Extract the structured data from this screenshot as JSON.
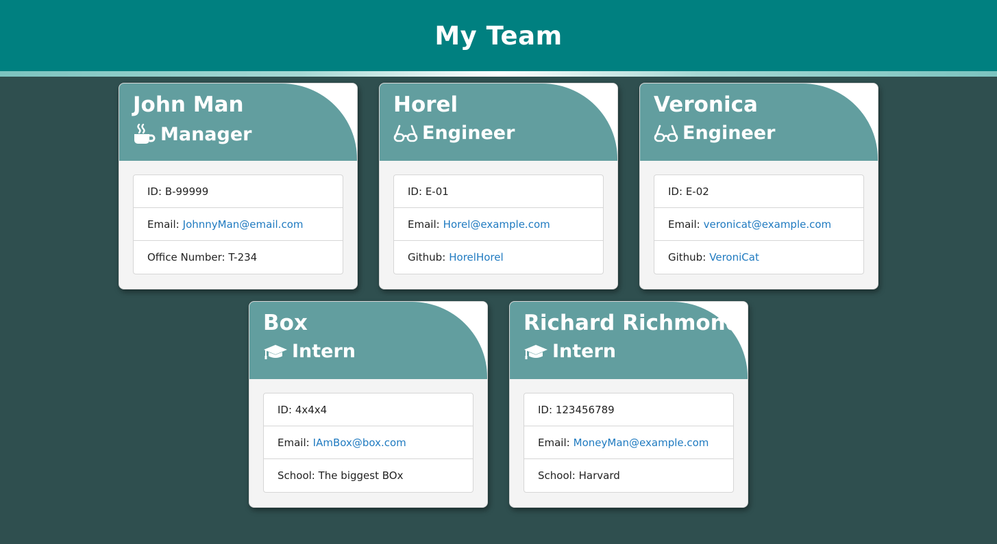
{
  "header": {
    "title": "My Team"
  },
  "employees": [
    {
      "name": "John Man",
      "role": "Manager",
      "role_icon": "coffee-icon",
      "id_label": "ID:",
      "id": "B-99999",
      "email_label": "Email:",
      "email": "JohnnyMan@email.com",
      "extra_label": "Office Number:",
      "extra": "T-234"
    },
    {
      "name": "Horel",
      "role": "Engineer",
      "role_icon": "glasses-icon",
      "id_label": "ID:",
      "id": "E-01",
      "email_label": "Email:",
      "email": "Horel@example.com",
      "extra_label": "Github:",
      "extra": "HorelHorel"
    },
    {
      "name": "Veronica",
      "role": "Engineer",
      "role_icon": "glasses-icon",
      "id_label": "ID:",
      "id": "E-02",
      "email_label": "Email:",
      "email": "veronicat@example.com",
      "extra_label": "Github:",
      "extra": "VeroniCat"
    },
    {
      "name": "Box",
      "role": "Intern",
      "role_icon": "graduation-cap-icon",
      "id_label": "ID:",
      "id": "4x4x4",
      "email_label": "Email:",
      "email": "IAmBox@box.com",
      "extra_label": "School:",
      "extra": "The biggest BOx"
    },
    {
      "name": "Richard Richmond",
      "role": "Intern",
      "role_icon": "graduation-cap-icon",
      "id_label": "ID:",
      "id": "123456789",
      "email_label": "Email:",
      "email": "MoneyMan@example.com",
      "extra_label": "School:",
      "extra": "Harvard"
    }
  ],
  "colors": {
    "header_bg": "#008080",
    "page_bg": "#2f4f4f",
    "card_header_bg": "#629e9f",
    "link": "#1f7ac0"
  }
}
